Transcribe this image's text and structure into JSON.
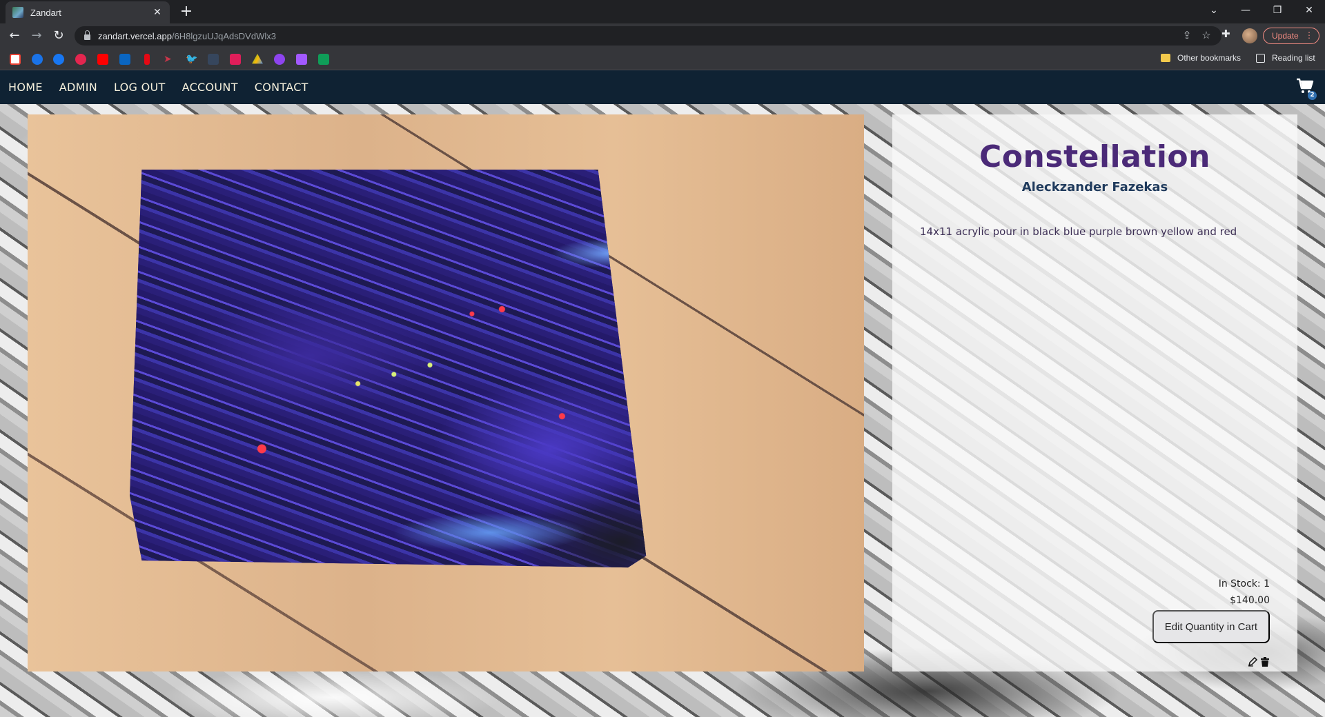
{
  "browser": {
    "tab_title": "Zandart",
    "new_tab": "+",
    "url_host": "zandart.vercel.app",
    "url_path": "/6H8lgzuUJqAdsDVdWlx3",
    "update_label": "Update",
    "bookmarks": {
      "other_bookmarks": "Other bookmarks",
      "reading_list": "Reading list",
      "icons": [
        "gmail-icon",
        "outlook-icon",
        "facebook-icon",
        "pocket-icon",
        "youtube-icon",
        "linkedin-icon",
        "netflix-icon",
        "arrow-icon",
        "twitter-icon",
        "tumblr-icon",
        "hashtag-icon",
        "drive-icon",
        "proton-icon",
        "stylus-icon",
        "sheets-icon"
      ]
    }
  },
  "nav": {
    "links": [
      "HOME",
      "ADMIN",
      "LOG OUT",
      "ACCOUNT",
      "CONTACT"
    ],
    "cart_count": "2"
  },
  "product": {
    "title": "Constellation",
    "artist": "Aleckzander Fazekas",
    "description": "14x11 acrylic pour in black blue purple brown yellow and red",
    "stock": "In Stock: 1",
    "price": "$140.00",
    "cart_button": "Edit Quantity in Cart"
  },
  "colors": {
    "nav_bg": "#0f2233",
    "nav_text": "#f5f0dc",
    "title": "#4b2a78",
    "artist": "#1f3a5c"
  }
}
